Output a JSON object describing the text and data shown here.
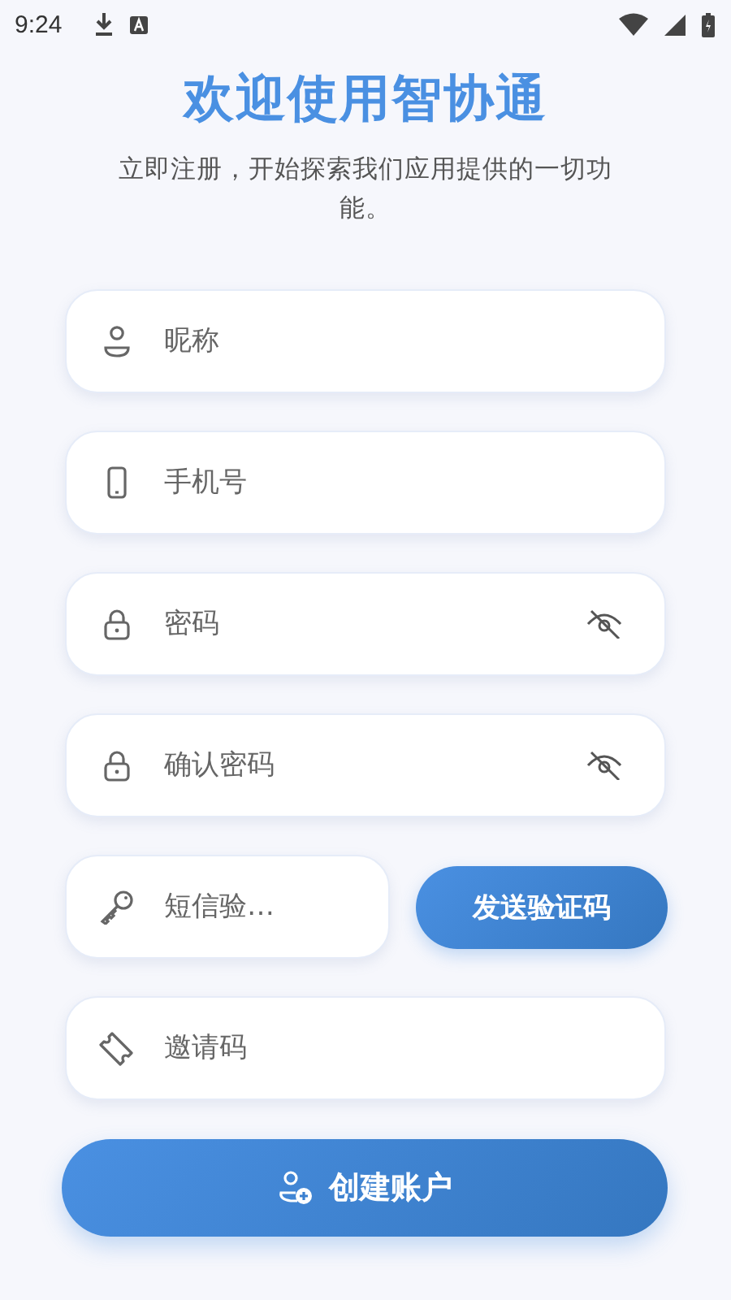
{
  "status_bar": {
    "time": "9:24"
  },
  "title": "欢迎使用智协通",
  "subtitle": "立即注册，开始探索我们应用提供的一切功能。",
  "fields": [
    {
      "kind": "nickname",
      "placeholder": "昵称"
    },
    {
      "kind": "phone",
      "placeholder": "手机号"
    },
    {
      "kind": "password",
      "placeholder": "密码",
      "visible": false
    },
    {
      "kind": "password",
      "placeholder": "确认密码",
      "visible": false
    },
    {
      "kind": "sms",
      "placeholder": "短信验…",
      "button": "发送验证码"
    },
    {
      "kind": "invite",
      "placeholder": "邀请码"
    }
  ],
  "submit": {
    "label": "创建账户"
  }
}
